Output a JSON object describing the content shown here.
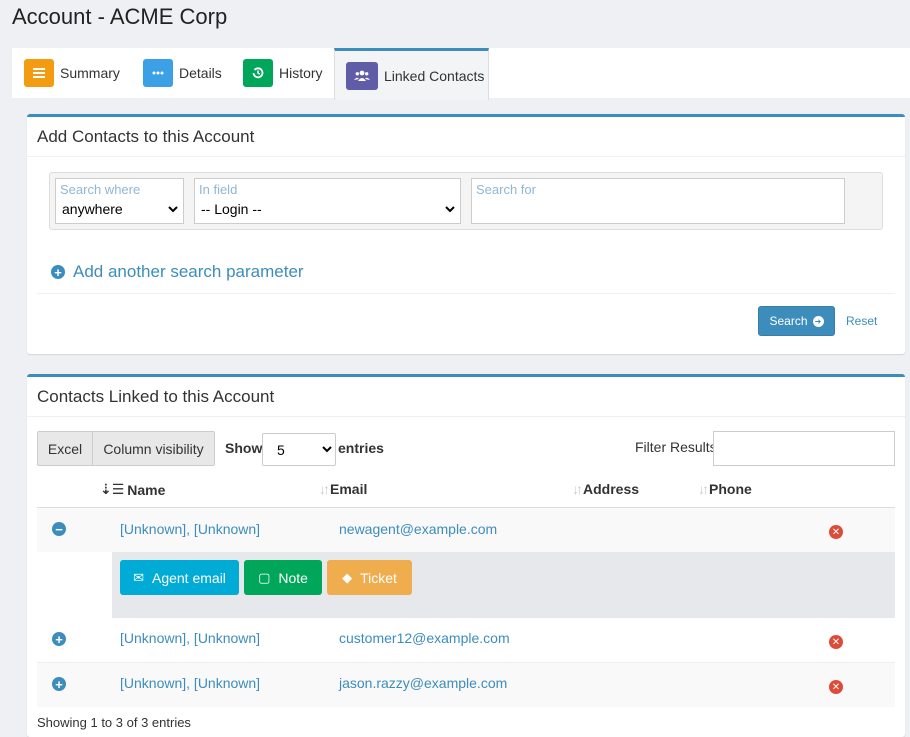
{
  "page": {
    "title": "Account - ACME Corp"
  },
  "tabs": [
    {
      "label": "Summary",
      "icon": "list-icon",
      "color": "#f39c12"
    },
    {
      "label": "Details",
      "icon": "dots-icon",
      "color": "#3c8dbc"
    },
    {
      "label": "History",
      "icon": "history-icon",
      "color": "#00a65a"
    },
    {
      "label": "Linked Contacts",
      "icon": "users-icon",
      "color": "#605ca8"
    }
  ],
  "add_contacts": {
    "title": "Add Contacts to this Account",
    "search_where": {
      "label": "Search where",
      "value": "anywhere"
    },
    "in_field": {
      "label": "In field",
      "value": "-- Login --"
    },
    "search_for": {
      "label": "Search for",
      "value": ""
    },
    "add_param": "Add another search parameter",
    "search_button": "Search",
    "reset_link": "Reset"
  },
  "linked": {
    "title": "Contacts Linked to this Account",
    "excel": "Excel",
    "column_visibility": "Column visibility",
    "show_label": "Show",
    "length_value": "5",
    "entries_label": "entries",
    "filter_label": "Filter Results",
    "columns": [
      "Name",
      "Email",
      "Address",
      "Phone"
    ],
    "rows": [
      {
        "name": "[Unknown], [Unknown]",
        "email": "newagent@example.com",
        "expanded": true
      },
      {
        "name": "[Unknown], [Unknown]",
        "email": "customer12@example.com",
        "expanded": false
      },
      {
        "name": "[Unknown], [Unknown]",
        "email": "jason.razzy@example.com",
        "expanded": false
      }
    ],
    "actions": {
      "agent_email": "Agent email",
      "note": "Note",
      "ticket": "Ticket"
    },
    "footer": "Showing 1 to 3 of 3 entries"
  },
  "colors": {
    "primary": "#3c8dbc",
    "danger": "#dd4b39",
    "info": "#00acd6",
    "success": "#00a65a",
    "warning": "#f0ad4e"
  }
}
